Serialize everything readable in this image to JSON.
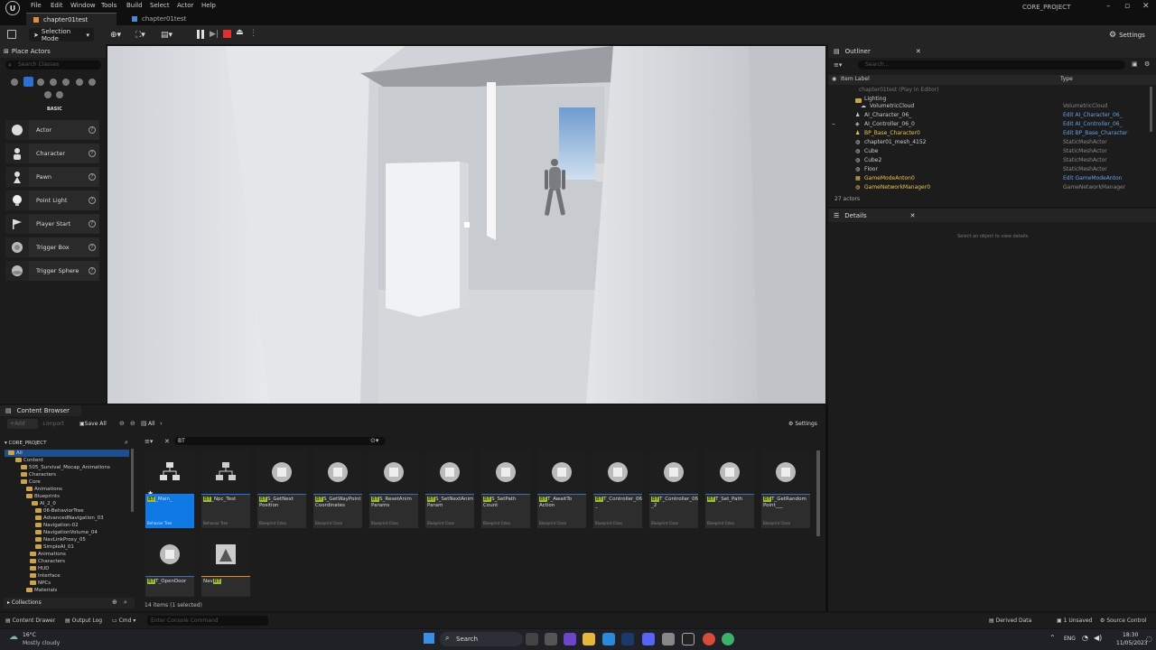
{
  "menu": [
    "File",
    "Edit",
    "Window",
    "Tools",
    "Build",
    "Select",
    "Actor",
    "Help"
  ],
  "tabs": {
    "active": "chapter01test",
    "second": "chapter01test"
  },
  "project_name": "CORE_PROJECT",
  "toolbar": {
    "selection_mode": "Selection Mode",
    "settings": "Settings"
  },
  "place_actors": {
    "title": "Place Actors",
    "search_placeholder": "Search Classes",
    "category": "BASIC",
    "items": [
      "Actor",
      "Character",
      "Pawn",
      "Point Light",
      "Player Start",
      "Trigger Box",
      "Trigger Sphere"
    ]
  },
  "outliner": {
    "title": "Outliner",
    "search_placeholder": "Search...",
    "col_label": "Item Label",
    "col_type": "Type",
    "rows": [
      {
        "name": "chapter01test (Play In Editor)",
        "type": ""
      },
      {
        "name": "Lighting",
        "type": ""
      },
      {
        "name": "VolumetricCloud",
        "type": "VolumetricCloud"
      },
      {
        "name": "AI_Character_06_",
        "type": "Edit AI_Character_06_"
      },
      {
        "name": "AI_Controller_06_0",
        "type": "Edit AI_Controller_06_"
      },
      {
        "name": "BP_Base_Character0",
        "type": "Edit BP_Base_Character"
      },
      {
        "name": "chapter01_mesh_4152",
        "type": "StaticMeshActor"
      },
      {
        "name": "Cube",
        "type": "StaticMeshActor"
      },
      {
        "name": "Cube2",
        "type": "StaticMeshActor"
      },
      {
        "name": "Floor",
        "type": "StaticMeshActor"
      },
      {
        "name": "GameModeAnton0",
        "type": "Edit GameModeAnton"
      },
      {
        "name": "GameNetworkManager0",
        "type": "GameNetworkManager"
      }
    ],
    "count": "27 actors"
  },
  "details": {
    "title": "Details",
    "empty": "Select an object to view details."
  },
  "content_browser": {
    "title": "Content Browser",
    "add": "Add",
    "import": "Import",
    "save_all": "Save All",
    "path": "All",
    "settings": "Settings",
    "filter_text": "BT",
    "project": "CORE_PROJECT",
    "tree": [
      "All",
      "Content",
      "505_Survival_Mocap_Animations",
      "Characters",
      "Core",
      "Animations",
      "Blueprints",
      "AI_2_0",
      "06-BehaviorTree",
      "AdvancedNavigation_03",
      "Navigation-02",
      "NavigationVolume_04",
      "NavLinkProxy_05",
      "SimpleAI_01",
      "Animations",
      "Characters",
      "HUD",
      "Interface",
      "NPCs",
      "Materials"
    ],
    "collections": "Collections",
    "items_status": "14 items (1 selected)",
    "assets": [
      {
        "tag": "BT",
        "name": "_Main_",
        "sub": "Behavior Tree"
      },
      {
        "tag": "BT",
        "name": "_Npc_Test",
        "sub": "Behavior Tree"
      },
      {
        "tag": "BT",
        "name": "S_GetNext Position",
        "sub": "Blueprint Class"
      },
      {
        "tag": "BT",
        "name": "S_GetWayPoint Coordinates",
        "sub": "Blueprint Class"
      },
      {
        "tag": "BT",
        "name": "S_ResetAnim Params",
        "sub": "Blueprint Class"
      },
      {
        "tag": "BT",
        "name": "S_SetNextAnim Param",
        "sub": "Blueprint Class"
      },
      {
        "tag": "BT",
        "name": "S_SetPath Count",
        "sub": "Blueprint Class"
      },
      {
        "tag": "BT",
        "name": "T_AwaitTo Action",
        "sub": "Blueprint Class"
      },
      {
        "tag": "BT",
        "name": "T_Controller_06 _",
        "sub": "Blueprint Class"
      },
      {
        "tag": "BT",
        "name": "T_Controller_06 _2",
        "sub": "Blueprint Class"
      },
      {
        "tag": "BT",
        "name": "T_Set_Path",
        "sub": "Blueprint Class"
      },
      {
        "tag": "BT",
        "name": "T_GetRandom Point___",
        "sub": "Blueprint Class"
      },
      {
        "tag": "BT",
        "name": "T_OpenDoor",
        "sub": ""
      },
      {
        "tag": "Nav",
        "name": "BT",
        "sub": ""
      }
    ]
  },
  "statusbar": {
    "content_drawer": "Content Drawer",
    "output_log": "Output Log",
    "cmd": "Cmd",
    "console_placeholder": "Enter Console Command",
    "derived": "Derived Data",
    "unsaved": "1 Unsaved",
    "source": "Source Control"
  },
  "taskbar": {
    "temp": "16°C",
    "weather": "Mostly cloudy",
    "search": "Search",
    "lang": "ENG",
    "time": "18:30",
    "date": "11/05/2023"
  }
}
